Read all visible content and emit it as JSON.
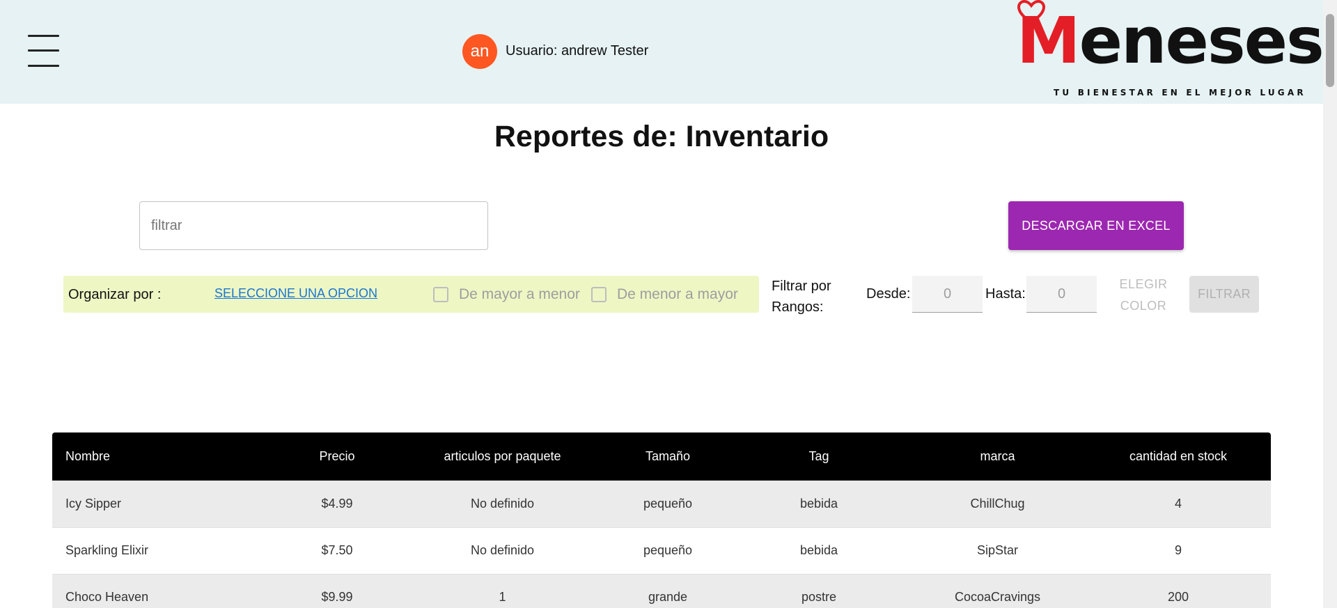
{
  "header": {
    "avatar_initials": "an",
    "user_label": "Usuario: andrew Tester",
    "logo": {
      "brand": "Meneses",
      "brand_first": "M",
      "brand_rest": "eneses",
      "tagline": "TU BIENESTAR EN EL MEJOR LUGAR"
    }
  },
  "page": {
    "title": "Reportes de: Inventario"
  },
  "filter": {
    "placeholder": "filtrar",
    "excel_button": "DESCARGAR EN EXCEL"
  },
  "sort": {
    "label": "Organizar por :",
    "select_option": "SELECCIONE UNA OPCION",
    "desc_label": "De mayor a menor",
    "asc_label": "De menor a mayor"
  },
  "range": {
    "label_line1": "Filtrar por",
    "label_line2": "Rangos:",
    "from_label": "Desde:",
    "from_value": "0",
    "to_label": "Hasta:",
    "to_value": "0",
    "color_line1": "ELEGIR",
    "color_line2": "COLOR",
    "filter_button": "FILTRAR"
  },
  "table": {
    "columns": [
      "Nombre",
      "Precio",
      "articulos por paquete",
      "Tamaño",
      "Tag",
      "marca",
      "cantidad en stock"
    ],
    "rows": [
      [
        "Icy Sipper",
        "$4.99",
        "No definido",
        "pequeño",
        "bebida",
        "ChillChug",
        "4"
      ],
      [
        "Sparkling Elixir",
        "$7.50",
        "No definido",
        "pequeño",
        "bebida",
        "SipStar",
        "9"
      ],
      [
        "Choco Heaven",
        "$9.99",
        "1",
        "grande",
        "postre",
        "CocoaCravings",
        "200"
      ]
    ]
  },
  "colors": {
    "header_bg": "#e6f2f3",
    "avatar": "#ff5722",
    "excel_button": "#9c27b0",
    "sort_bar": "#eef6c4",
    "link": "#1976d2",
    "logo_red": "#e41e26",
    "table_header": "#000000"
  },
  "icons": {
    "menu": "hamburger-menu-icon",
    "logo_heart": "heart-icon"
  }
}
